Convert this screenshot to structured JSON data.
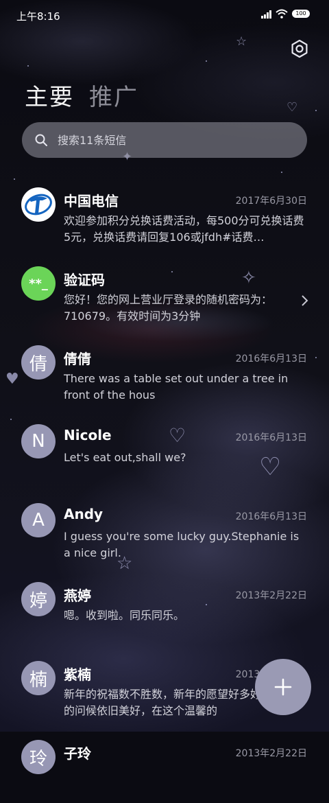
{
  "status_bar": {
    "time": "上午8:16",
    "battery": "100"
  },
  "tabs": [
    {
      "label": "主要",
      "active": true
    },
    {
      "label": "推广",
      "active": false
    }
  ],
  "search": {
    "placeholder": "搜索11条短信"
  },
  "messages": [
    {
      "avatar": "",
      "avatar_icon": "china-telecom-logo",
      "name": "中国电信",
      "date": "2017年6月30日",
      "preview": "欢迎参加积分兑换话费活动，每500分可兑换话费5元，兑换话费请回复106或jfdh#话费…"
    },
    {
      "avatar": "**_",
      "avatar_color": "#6bd458",
      "name": "验证码",
      "date": "",
      "preview": "您好！您的网上营业厅登录的随机密码为：710679。有效时间为3分钟"
    },
    {
      "avatar": "倩",
      "name": "倩倩",
      "date": "2016年6月13日",
      "preview": "There was a table set out under a tree in front of the hous"
    },
    {
      "avatar": "N",
      "name": "Nicole",
      "date": "2016年6月13日",
      "preview": "Let's eat out,shall we?"
    },
    {
      "avatar": "A",
      "name": "Andy",
      "date": "2016年6月13日",
      "preview": "I guess you're some lucky guy.Stephanie is a nice girl."
    },
    {
      "avatar": "婷",
      "name": "燕婷",
      "date": "2013年2月22日",
      "preview": "嗯。收到啦。同乐同乐。"
    },
    {
      "avatar": "楠",
      "name": "紫楠",
      "date": "2013年2月22日",
      "preview": "新年的祝福数不胜数，新年的愿望好多好多，新年的问候依旧美好，在这个温馨的"
    },
    {
      "avatar": "玲",
      "name": "子玲",
      "date": "2013年2月22日",
      "preview": ""
    }
  ],
  "fab": {
    "icon": "plus-icon"
  }
}
